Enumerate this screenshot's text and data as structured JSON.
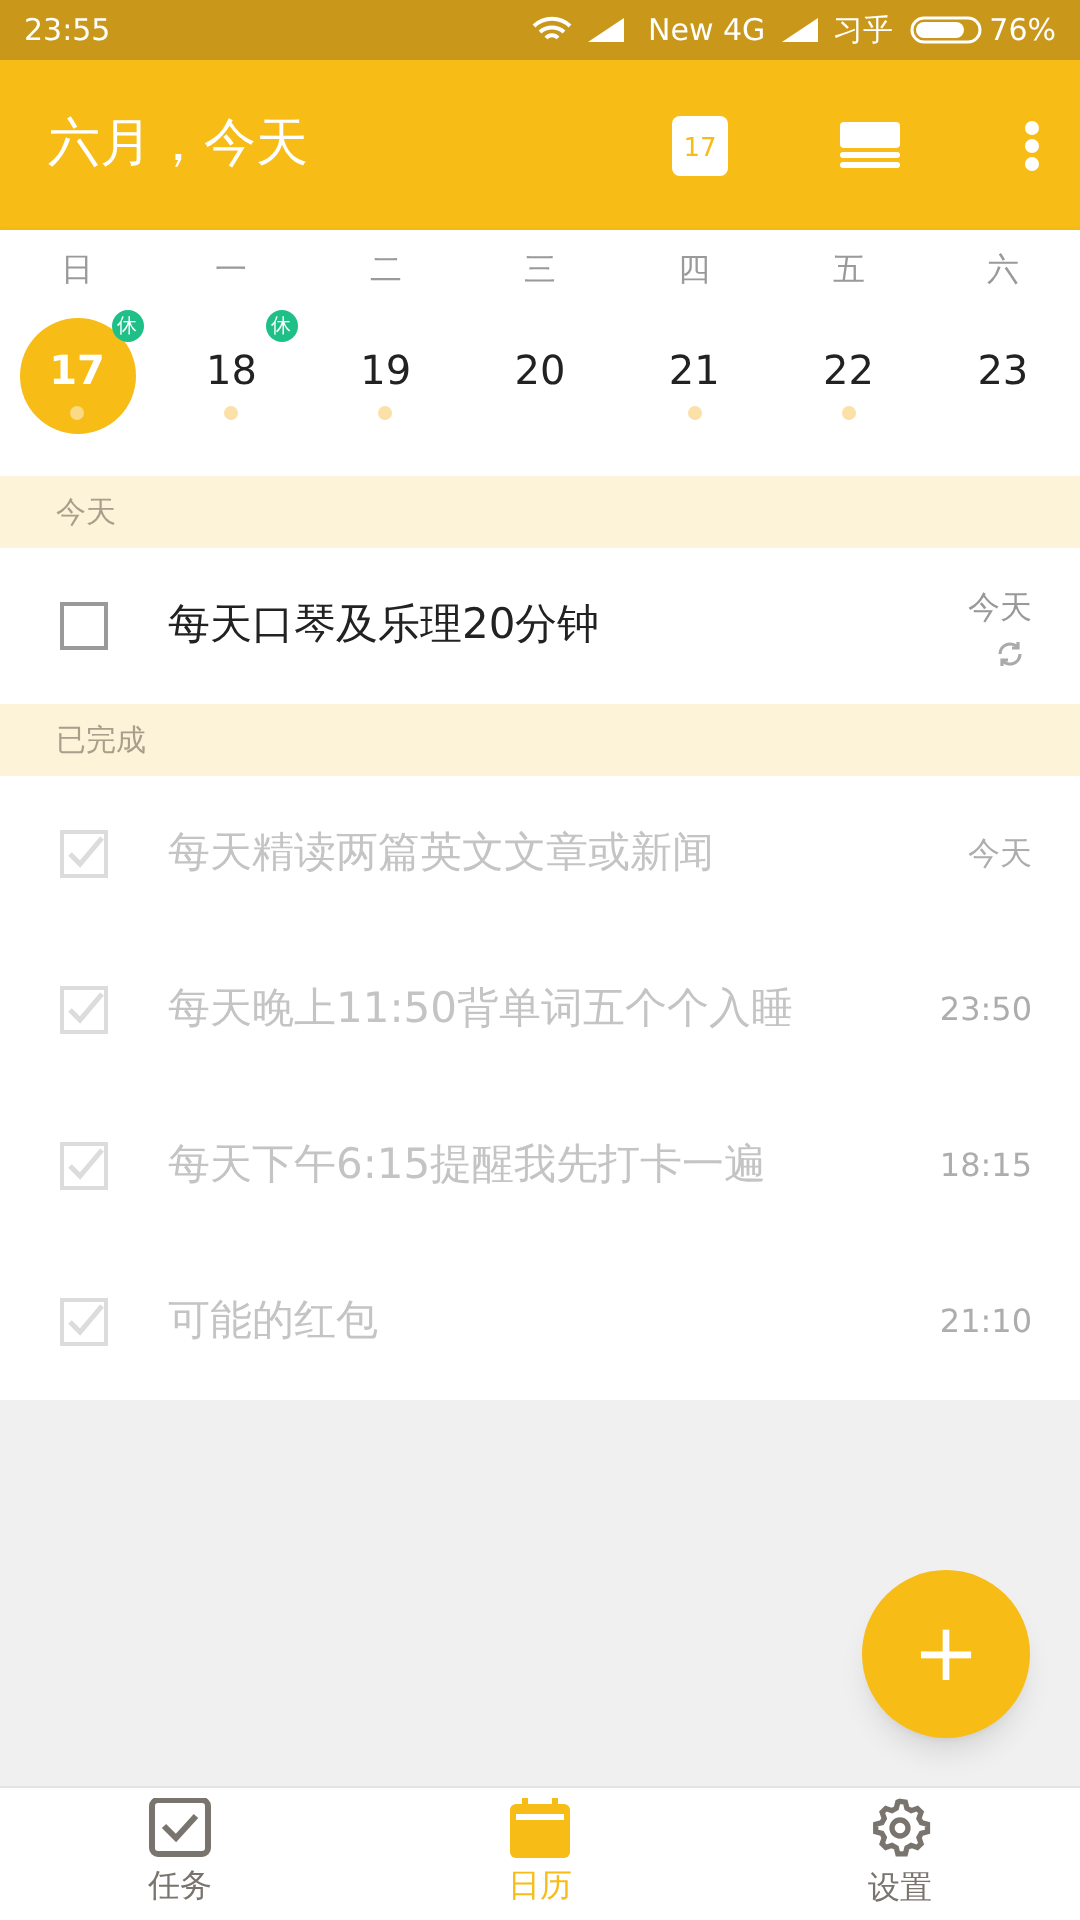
{
  "status_bar": {
    "time": "23:55",
    "network": "New 4G",
    "carrier": "习乎",
    "battery": "76%"
  },
  "header": {
    "title": "六月，今天",
    "calendar_day": "17"
  },
  "week": [
    {
      "weekday": "日",
      "date": "17",
      "selected": true,
      "badge": "休",
      "has_tasks": true
    },
    {
      "weekday": "一",
      "date": "18",
      "selected": false,
      "badge": "休",
      "has_tasks": true
    },
    {
      "weekday": "二",
      "date": "19",
      "selected": false,
      "has_tasks": true
    },
    {
      "weekday": "三",
      "date": "20",
      "selected": false,
      "has_tasks": false
    },
    {
      "weekday": "四",
      "date": "21",
      "selected": false,
      "has_tasks": true
    },
    {
      "weekday": "五",
      "date": "22",
      "selected": false,
      "has_tasks": true
    },
    {
      "weekday": "六",
      "date": "23",
      "selected": false,
      "has_tasks": false
    }
  ],
  "sections": [
    {
      "title": "今天",
      "tasks": [
        {
          "title": "每天口琴及乐理20分钟",
          "time": "今天",
          "checked": false,
          "repeat": true
        }
      ]
    },
    {
      "title": "已完成",
      "tasks": [
        {
          "title": "每天精读两篇英文文章或新闻",
          "time": "今天",
          "checked": true,
          "repeat": false
        },
        {
          "title": "每天晚上11:50背单词五个个入睡",
          "time": "23:50",
          "checked": true,
          "repeat": false
        },
        {
          "title": "每天下午6:15提醒我先打卡一遍",
          "time": "18:15",
          "checked": true,
          "repeat": false
        },
        {
          "title": "可能的红包",
          "time": "21:10",
          "checked": true,
          "repeat": false
        }
      ]
    }
  ],
  "fab": {
    "label": "+"
  },
  "bottom_nav": [
    {
      "label": "任务",
      "kind": "check",
      "selected": false
    },
    {
      "label": "日历",
      "kind": "calendar",
      "selected": true
    },
    {
      "label": "设置",
      "kind": "gear",
      "selected": false
    }
  ]
}
